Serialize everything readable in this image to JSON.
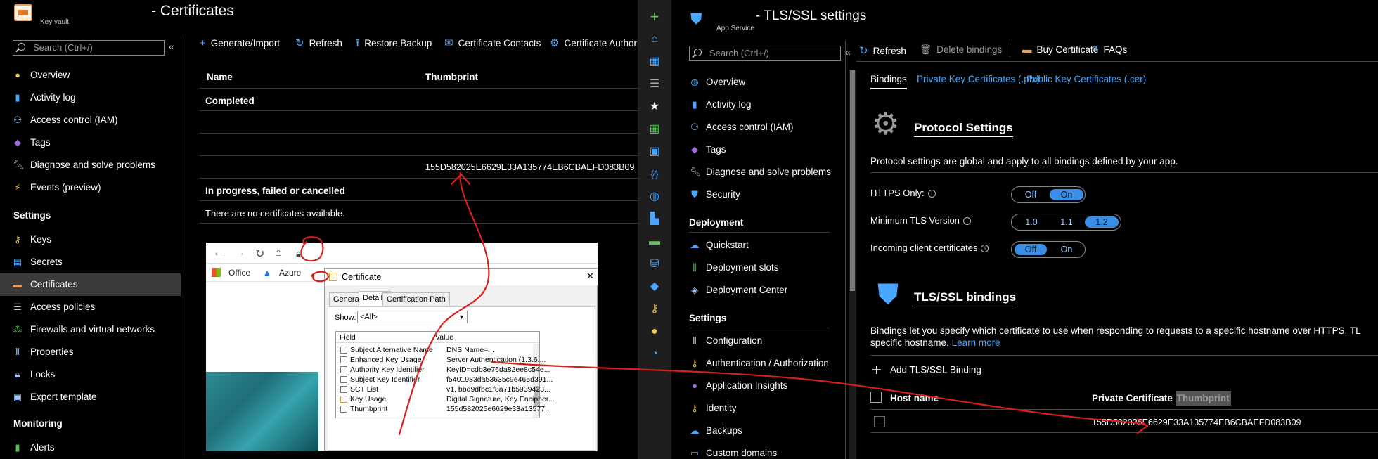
{
  "keyvault": {
    "title": "- Certificates",
    "subtitle": "Key vault",
    "search_placeholder": "Search (Ctrl+/)",
    "collapse": "«",
    "nav": [
      {
        "label": "Overview",
        "icon": "globe-icon"
      },
      {
        "label": "Activity log",
        "icon": "log-icon"
      },
      {
        "label": "Access control (IAM)",
        "icon": "people-icon"
      },
      {
        "label": "Tags",
        "icon": "tag-icon"
      },
      {
        "label": "Diagnose and solve problems",
        "icon": "wrench-icon"
      },
      {
        "label": "Events (preview)",
        "icon": "lightning-icon"
      }
    ],
    "settings_heading": "Settings",
    "settings_nav": [
      {
        "label": "Keys",
        "icon": "key-icon"
      },
      {
        "label": "Secrets",
        "icon": "secret-icon"
      },
      {
        "label": "Certificates",
        "icon": "certificate-icon"
      },
      {
        "label": "Access policies",
        "icon": "list-icon"
      },
      {
        "label": "Firewalls and virtual networks",
        "icon": "network-icon"
      },
      {
        "label": "Properties",
        "icon": "properties-icon"
      },
      {
        "label": "Locks",
        "icon": "lock-icon"
      },
      {
        "label": "Export template",
        "icon": "export-icon"
      }
    ],
    "monitoring_heading": "Monitoring",
    "monitoring_nav": [
      {
        "label": "Alerts",
        "icon": "alert-icon"
      }
    ],
    "toolbar": {
      "generate": "Generate/Import",
      "refresh": "Refresh",
      "restore": "Restore Backup",
      "contacts": "Certificate Contacts",
      "authorities": "Certificate Authorities"
    },
    "table": {
      "col_name": "Name",
      "col_thumbprint": "Thumbprint",
      "group_completed": "Completed",
      "rows": [
        {
          "name": "",
          "thumbprint": ""
        },
        {
          "name": "",
          "thumbprint": ""
        },
        {
          "name": "",
          "thumbprint": "155D582025E6629E33A135774EB6CBAEFD083B09"
        }
      ],
      "group_progress": "In progress, failed or cancelled",
      "empty_text": "There are no certificates available."
    }
  },
  "browser_inset": {
    "bookmarks": [
      "Office",
      "Azure"
    ],
    "dialog": {
      "title": "Certificate",
      "tabs": [
        "General",
        "Details",
        "Certification Path"
      ],
      "show_label": "Show:",
      "show_value": "<All>",
      "col_field": "Field",
      "col_value": "Value",
      "fields": [
        {
          "field": "Subject Alternative Name",
          "value": "DNS Name=..."
        },
        {
          "field": "Enhanced Key Usage",
          "value": "Server Authentication (1.3.6...."
        },
        {
          "field": "Authority Key Identifier",
          "value": "KeyID=cdb3e76da82ee8c54e..."
        },
        {
          "field": "Subject Key Identifier",
          "value": "f5401983da53635c9e465d391..."
        },
        {
          "field": "SCT List",
          "value": "v1, bbd9dfbc1f8a71b5939423..."
        },
        {
          "field": "Key Usage",
          "value": "Digital Signature, Key Encipher..."
        },
        {
          "field": "Thumbprint",
          "value": "155d582025e6629e33a13577..."
        }
      ]
    }
  },
  "appservice": {
    "title": "- TLS/SSL settings",
    "subtitle": "App Service",
    "search_placeholder": "Search (Ctrl+/)",
    "collapse": "«",
    "nav": [
      {
        "label": "Overview",
        "icon": "globe-icon"
      },
      {
        "label": "Activity log",
        "icon": "log-icon"
      },
      {
        "label": "Access control (IAM)",
        "icon": "people-icon"
      },
      {
        "label": "Tags",
        "icon": "tag-icon"
      },
      {
        "label": "Diagnose and solve problems",
        "icon": "wrench-icon"
      },
      {
        "label": "Security",
        "icon": "shield-icon"
      }
    ],
    "deployment_heading": "Deployment",
    "deployment_nav": [
      {
        "label": "Quickstart",
        "icon": "cloud-icon"
      },
      {
        "label": "Deployment slots",
        "icon": "slots-icon"
      },
      {
        "label": "Deployment Center",
        "icon": "cube-icon"
      }
    ],
    "settings_heading": "Settings",
    "settings_nav": [
      {
        "label": "Configuration",
        "icon": "config-icon"
      },
      {
        "label": "Authentication / Authorization",
        "icon": "key-icon"
      },
      {
        "label": "Application Insights",
        "icon": "bulb-icon"
      },
      {
        "label": "Identity",
        "icon": "identity-icon"
      },
      {
        "label": "Backups",
        "icon": "backup-icon"
      },
      {
        "label": "Custom domains",
        "icon": "domain-icon"
      }
    ],
    "toolbar": {
      "refresh": "Refresh",
      "delete": "Delete bindings",
      "buy": "Buy Certificate",
      "faqs": "FAQs"
    },
    "tabs": [
      "Bindings",
      "Private Key Certificates (.pfx)",
      "Public Key Certificates (.cer)"
    ],
    "protocol": {
      "heading": "Protocol Settings",
      "description": "Protocol settings are global and apply to all bindings defined by your app.",
      "https_label": "HTTPS Only:",
      "https_options": [
        "Off",
        "On"
      ],
      "https_selected": "On",
      "tls_label": "Minimum TLS Version",
      "tls_options": [
        "1.0",
        "1.1",
        "1.2"
      ],
      "tls_selected": "1.2",
      "client_label": "Incoming client certificates",
      "client_options": [
        "Off",
        "On"
      ],
      "client_selected": "Off"
    },
    "bindings": {
      "heading": "TLS/SSL bindings",
      "description_1": "Bindings let you specify which certificate to use when responding to requests to a specific hostname over HTTPS. TL",
      "description_2": "specific hostname.",
      "learn_more": "Learn more",
      "add_label": "Add TLS/SSL Binding",
      "col_host": "Host name",
      "col_cert": "Private Certificate",
      "col_cert_highlight": "Thumbprint",
      "rows": [
        {
          "host": "",
          "thumbprint": "155D582025E6629E33A135774EB6CBAEFD083B09"
        }
      ]
    }
  },
  "colors": {
    "accent": "#3a8ee6",
    "link": "#4aa6ff",
    "annotation": "#d61f1f"
  }
}
